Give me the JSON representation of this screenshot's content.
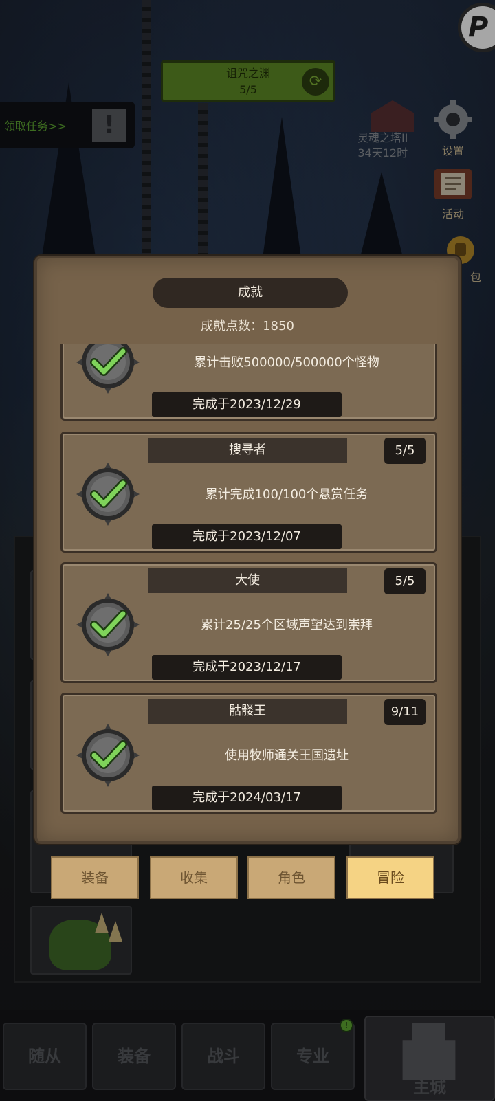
{
  "hud": {
    "quest_banner_title": "诅咒之渊",
    "quest_banner_progress": "5/5",
    "claim_task_label": "领取任务>>",
    "tower_name": "灵魂之塔II",
    "tower_timer": "34天12时",
    "settings_label": "设置",
    "events_label": "活动",
    "bag_label": "包"
  },
  "modal": {
    "title": "成就",
    "points_label": "成就点数：1850",
    "achievements": [
      {
        "name": "",
        "progress": "",
        "description": "累计击败500000/500000个怪物",
        "completed": "完成于2023/12/29"
      },
      {
        "name": "搜寻者",
        "progress": "5/5",
        "description": "累计完成100/100个悬赏任务",
        "completed": "完成于2023/12/07"
      },
      {
        "name": "大使",
        "progress": "5/5",
        "description": "累计25/25个区域声望达到崇拜",
        "completed": "完成于2023/12/17"
      },
      {
        "name": "骷髅王",
        "progress": "9/11",
        "description": "使用牧师通关王国遗址",
        "completed": "完成于2024/03/17"
      }
    ]
  },
  "category_tabs": [
    {
      "label": "装备",
      "active": false
    },
    {
      "label": "收集",
      "active": false
    },
    {
      "label": "角色",
      "active": false
    },
    {
      "label": "冒险",
      "active": true
    }
  ],
  "bottom_nav": [
    {
      "label": "随从"
    },
    {
      "label": "装备"
    },
    {
      "label": "战斗"
    },
    {
      "label": "专业"
    },
    {
      "label": "主城"
    }
  ],
  "notification_badge": "!",
  "colors": {
    "modal_bg": "#76624a",
    "check_green": "#7fd35a",
    "active_tab": "#f5d384",
    "quest_green": "#5e8a25"
  }
}
